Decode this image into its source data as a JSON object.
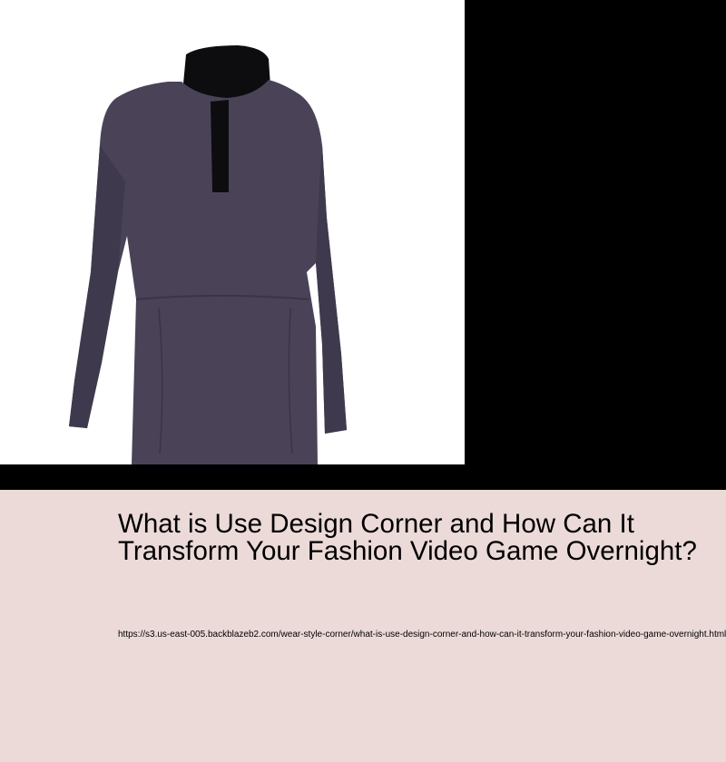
{
  "hero": {
    "image": {
      "subject": "dress-illustration",
      "colors": {
        "background": "#ffffff",
        "fabric": "#4a4358",
        "fabric_shadow": "#3a3447",
        "mannequin": "#0d0d10"
      }
    }
  },
  "article": {
    "title": "What is Use Design Corner and How Can It Transform Your Fashion Video Game Overnight?",
    "url": "https://s3.us-east-005.backblazeb2.com/wear-style-corner/what-is-use-design-corner-and-how-can-it-transform-your-fashion-video-game-overnight.html"
  },
  "theme": {
    "page_background": "#000000",
    "content_background": "#ecdad9",
    "text_color": "#000000"
  }
}
